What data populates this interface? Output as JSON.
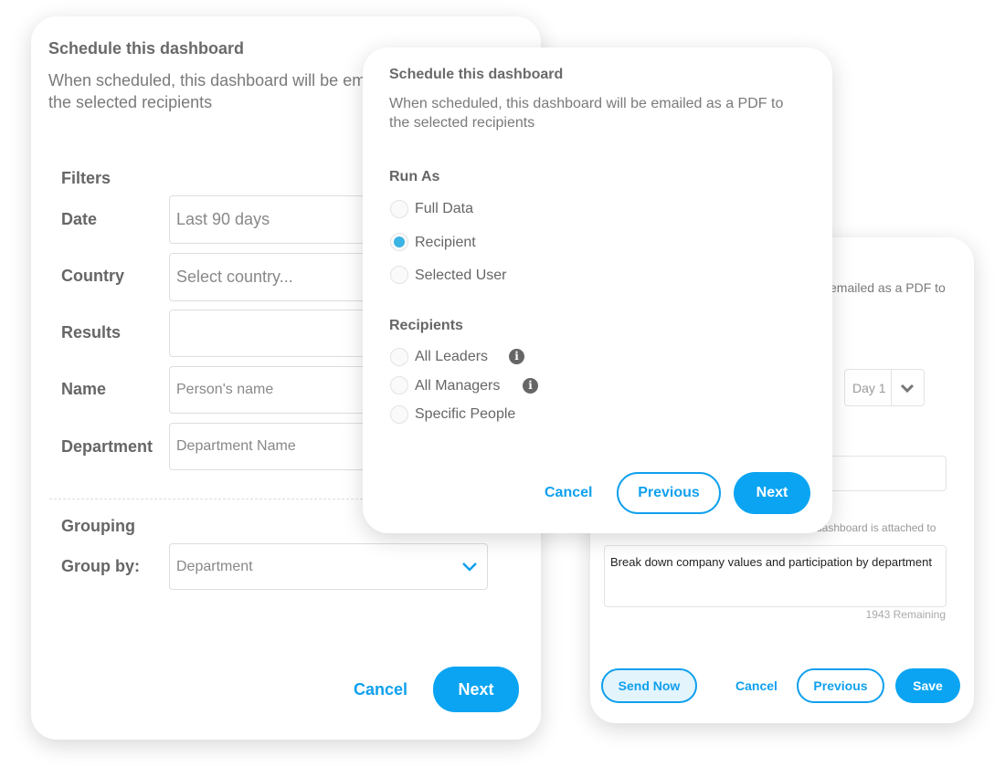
{
  "filters_card": {
    "title": "Schedule this dashboard",
    "description_line1": "When scheduled, this dashboard will be em",
    "description_line2": "the selected recipients",
    "filters_heading": "Filters",
    "fields": [
      {
        "label": "Date",
        "value": "Last 90 days"
      },
      {
        "label": "Country",
        "placeholder": "Select country..."
      },
      {
        "label": "Results",
        "value": ""
      },
      {
        "label": "Name",
        "placeholder": "Person's name"
      },
      {
        "label": "Department",
        "placeholder": "Department Name"
      }
    ],
    "grouping_heading": "Grouping",
    "group_by_label": "Group by:",
    "group_by_value": "Department",
    "cancel": "Cancel",
    "next": "Next"
  },
  "run_as_card": {
    "title": "Schedule this dashboard",
    "description_line1": "When scheduled, this dashboard will be emailed as a PDF to",
    "description_line2": "the selected recipients",
    "run_as_heading": "Run As",
    "run_as_options": [
      {
        "label": "Full Data",
        "selected": false
      },
      {
        "label": "Recipient",
        "selected": true
      },
      {
        "label": "Selected User",
        "selected": false
      }
    ],
    "recipients_heading": "Recipients",
    "recipient_options": [
      {
        "label": "All Leaders",
        "info": true
      },
      {
        "label": "All Managers",
        "info": true
      },
      {
        "label": "Specific People",
        "info": false
      }
    ],
    "cancel": "Cancel",
    "previous": "Previous",
    "next": "Next"
  },
  "message_card": {
    "description_fragment": "emailed as a PDF to",
    "day_select": "Day 1",
    "label_fragment": "dashboard is attached to",
    "message": "Break down company values and participation by department",
    "remaining": "1943 Remaining",
    "send_now": "Send Now",
    "cancel": "Cancel",
    "previous": "Previous",
    "save": "Save"
  },
  "colors": {
    "accent": "#0aa4f2",
    "radio_selected": "#3bb3e3"
  }
}
